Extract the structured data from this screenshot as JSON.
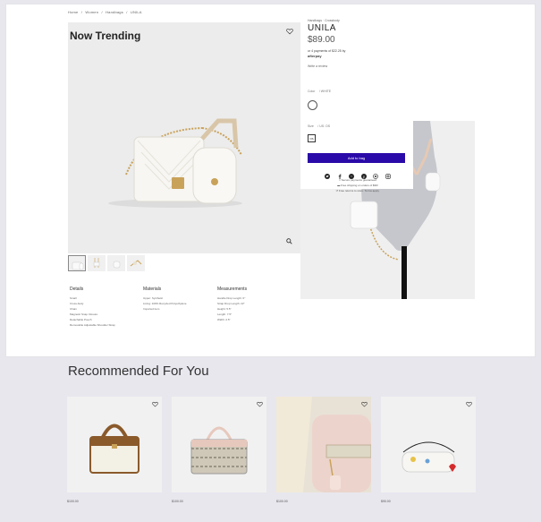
{
  "breadcrumb": [
    "Home",
    "/",
    "Women",
    "/",
    "Handbags",
    "/",
    "UNILA"
  ],
  "hero": {
    "title": "Now Trending"
  },
  "product": {
    "category": "Handbags · Crossbody",
    "name": "UNILA",
    "price": "$89.00",
    "installments_text": "or 4 payments of $22.25 by",
    "installments_provider": "afterpay",
    "write_review": "Write a review",
    "color_label": "Color",
    "color_value": "/ WHITE",
    "size_label": "Size",
    "size_value": "/ US: OS",
    "size_option": "OS",
    "add_to_bag": "Add to bag",
    "social_icons": [
      "twitter",
      "facebook",
      "messenger",
      "pinterest",
      "whatsapp",
      "instagram"
    ],
    "perks": [
      "Secure payments guaranteed",
      "Free shipping on orders of $99!",
      "Free returns to store. Terms apply."
    ]
  },
  "specs": {
    "details": {
      "heading": "Details",
      "lines": [
        "Small",
        "Cross-body",
        "Chain",
        "Magnetic Snap Closure",
        "Detachable Pouch",
        "Removable Adjustable Shoulder Strap"
      ]
    },
    "materials": {
      "heading": "Materials",
      "lines": [
        "Upper: Synthetic",
        "Lining: 100% Recycled Polyethylene",
        "Imported item"
      ]
    },
    "measurements": {
      "heading": "Measurements",
      "lines": [
        "Handle Drop Length: 0\"",
        "Strap Drop Length: 22\"",
        "Height: 5.5\"",
        "Length: 7.5\"",
        "Width: 2.5\""
      ]
    }
  },
  "recommended": {
    "title": "Recommended For You",
    "items": [
      {
        "price": "$100.00"
      },
      {
        "price": "$100.00"
      },
      {
        "price": "$100.00"
      },
      {
        "price": "$90.00"
      }
    ]
  },
  "colors": {
    "accent": "#2a0aa8",
    "page_bg": "#e8e7ee"
  }
}
